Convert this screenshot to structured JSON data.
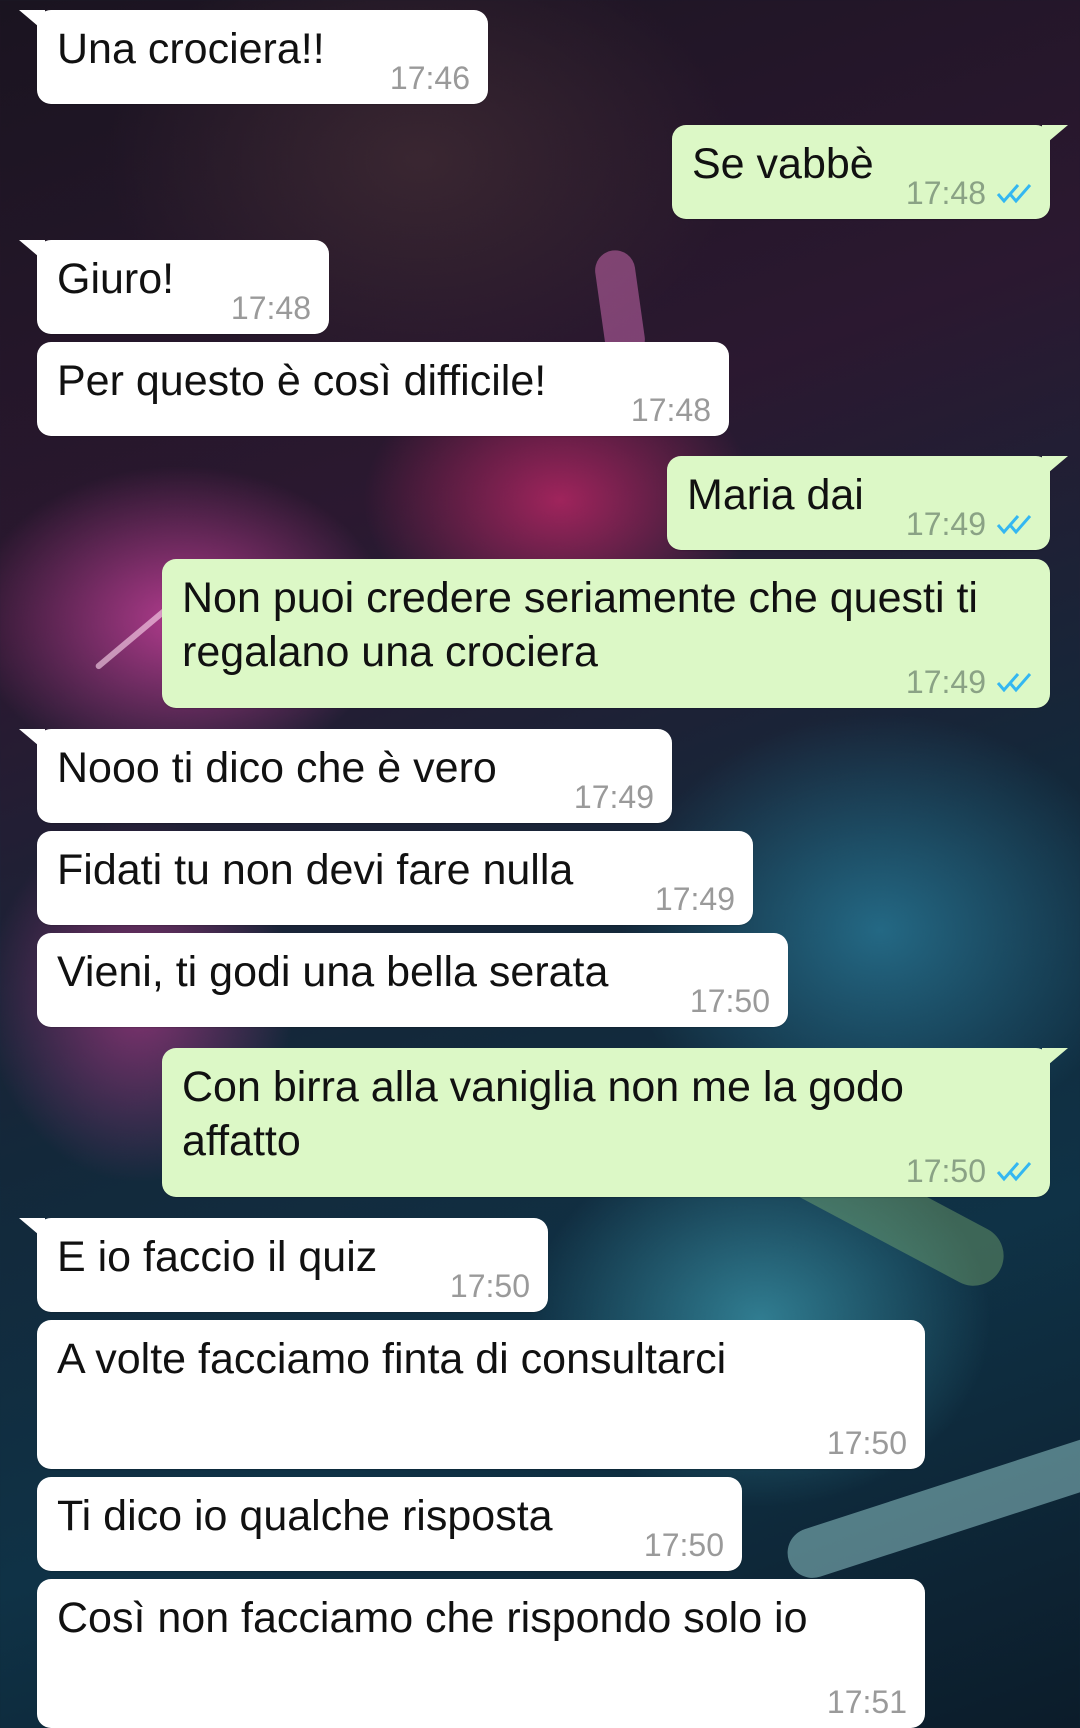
{
  "colors": {
    "incoming_bubble": "#ffffff",
    "outgoing_bubble": "#dcf8c6",
    "timestamp": "#9a9a9a",
    "read_ticks": "#34b7f1"
  },
  "messages": [
    {
      "direction": "in",
      "text": "Una crociera!!",
      "time": "17:46"
    },
    {
      "direction": "out",
      "text": "Se vabbè",
      "time": "17:48",
      "status": "read-double-check-icon"
    },
    {
      "direction": "in",
      "text": "Giuro!",
      "time": "17:48"
    },
    {
      "direction": "in",
      "text": "Per questo è così difficile!",
      "time": "17:48"
    },
    {
      "direction": "out",
      "text": "Maria dai",
      "time": "17:49",
      "status": "read-double-check-icon"
    },
    {
      "direction": "out",
      "text": "Non puoi credere seriamente che questi ti regalano una crociera",
      "time": "17:49",
      "status": "read-double-check-icon"
    },
    {
      "direction": "in",
      "text": "Nooo ti dico che è vero",
      "time": "17:49"
    },
    {
      "direction": "in",
      "text": "Fidati tu non devi fare nulla",
      "time": "17:49"
    },
    {
      "direction": "in",
      "text": "Vieni, ti godi una bella serata",
      "time": "17:50"
    },
    {
      "direction": "out",
      "text": "Con birra alla vaniglia non me la godo affatto",
      "time": "17:50",
      "status": "read-double-check-icon"
    },
    {
      "direction": "in",
      "text": "E io faccio il quiz",
      "time": "17:50"
    },
    {
      "direction": "in",
      "text": "A volte facciamo finta di consultarci",
      "time": "17:50"
    },
    {
      "direction": "in",
      "text": "Ti dico io qualche risposta",
      "time": "17:50"
    },
    {
      "direction": "in",
      "text": "Così non facciamo che rispondo solo io",
      "time": "17:51"
    }
  ]
}
